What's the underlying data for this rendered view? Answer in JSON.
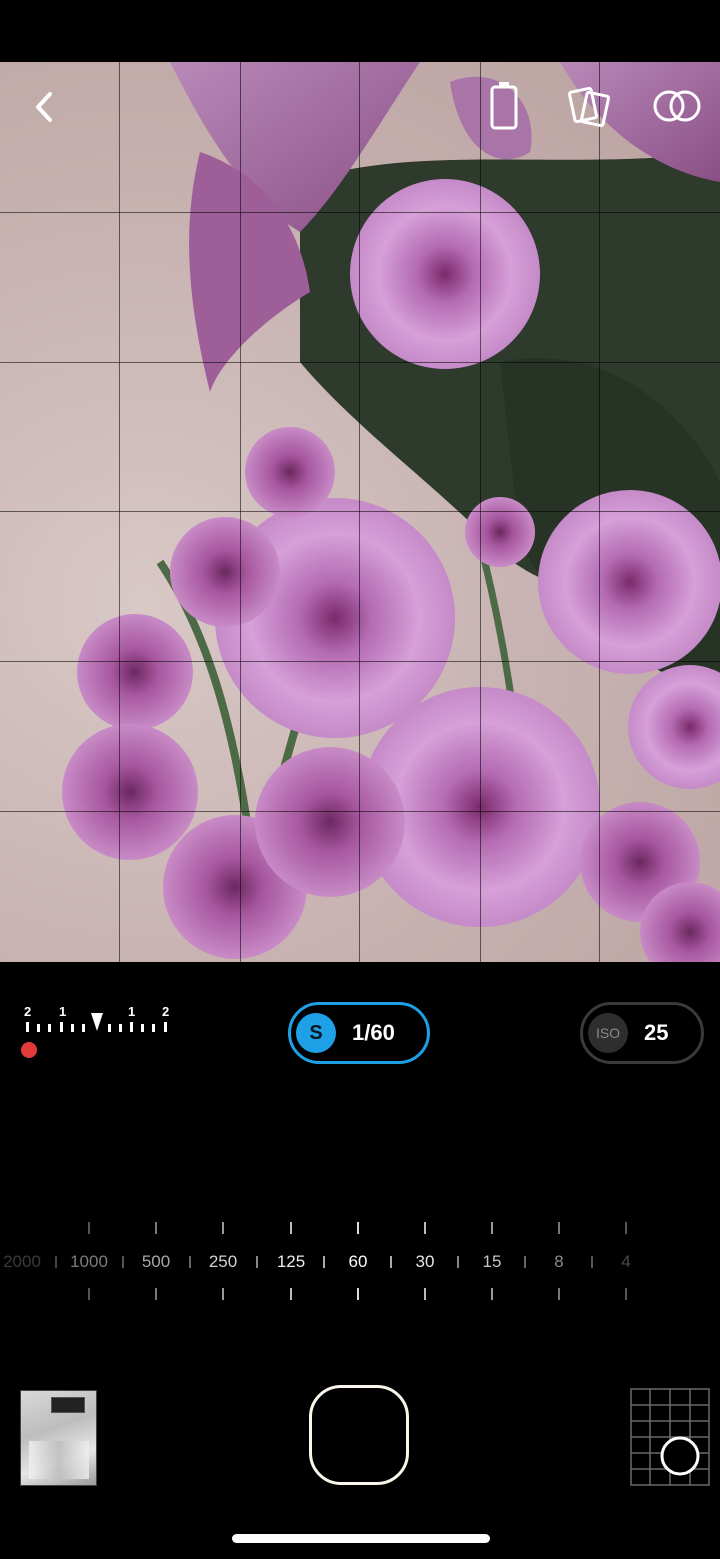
{
  "exposure_meter": {
    "scale_labels": [
      "2",
      "1",
      "1",
      "2"
    ],
    "indicator_color": "#e03a3a"
  },
  "shutter": {
    "badge": "S",
    "value": "1/60",
    "accent": "#1ea0e6"
  },
  "iso": {
    "badge": "ISO",
    "value": "25"
  },
  "shutter_scale": {
    "labels": [
      "2000",
      "1000",
      "500",
      "250",
      "125",
      "60",
      "30",
      "15",
      "8",
      "4"
    ],
    "selected": "60"
  },
  "icons": {
    "back": "chevron-left-icon",
    "battery": "battery-icon",
    "lens": "lens-flip-icon",
    "overlay": "double-exposure-icon",
    "grid": "grid-icon"
  }
}
